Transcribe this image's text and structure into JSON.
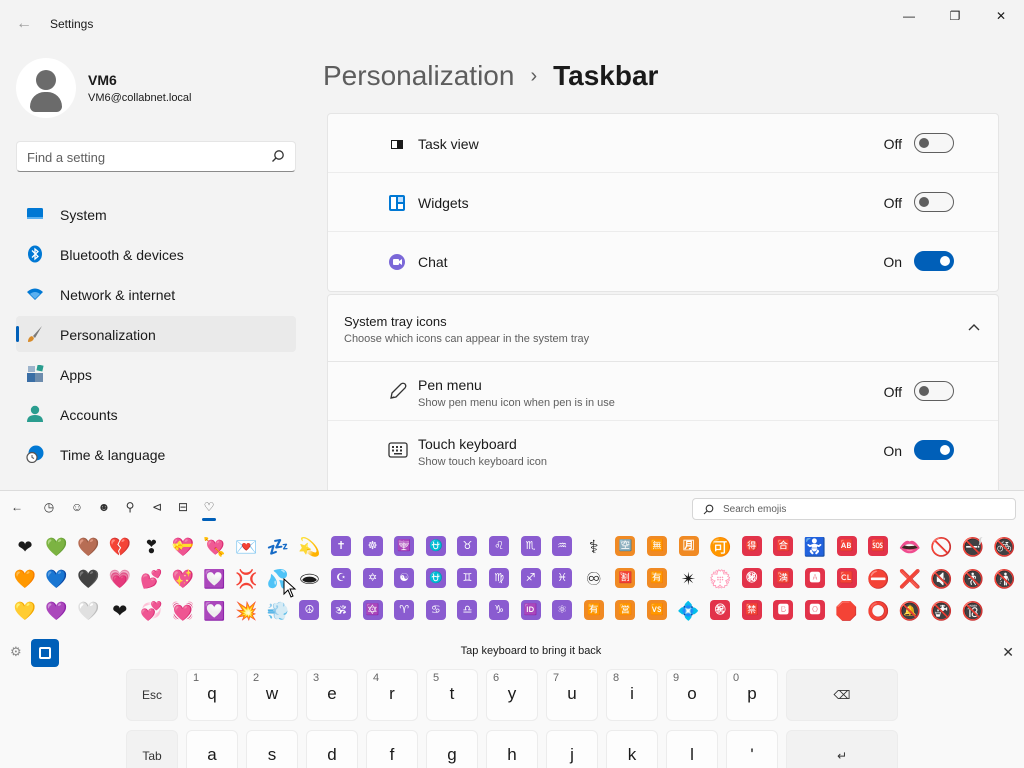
{
  "window": {
    "title": "Settings",
    "back_icon": "←",
    "minimize_icon": "—",
    "maximize_icon": "❐",
    "close_icon": "✕"
  },
  "profile": {
    "name": "VM6",
    "email": "VM6@collabnet.local"
  },
  "search": {
    "placeholder": "Find a setting"
  },
  "sidebar": {
    "items": [
      {
        "label": "System",
        "icon": "system-icon",
        "color": "#0078d4"
      },
      {
        "label": "Bluetooth & devices",
        "icon": "bluetooth-icon",
        "color": "#0078d4"
      },
      {
        "label": "Network & internet",
        "icon": "wifi-icon",
        "color": "#0078d4"
      },
      {
        "label": "Personalization",
        "icon": "brush-icon",
        "color": "#d88b2a",
        "active": true
      },
      {
        "label": "Apps",
        "icon": "apps-icon",
        "color": "#3a6ea5"
      },
      {
        "label": "Accounts",
        "icon": "person-icon",
        "color": "#2a9d8f"
      },
      {
        "label": "Time & language",
        "icon": "globe-clock-icon",
        "color": "#0078d4"
      }
    ]
  },
  "breadcrumb": {
    "parent": "Personalization",
    "separator": "›",
    "current": "Taskbar"
  },
  "taskbar_items": [
    {
      "label": "Task view",
      "state": "Off",
      "icon": "task-view-icon"
    },
    {
      "label": "Widgets",
      "state": "Off",
      "icon": "widgets-icon"
    },
    {
      "label": "Chat",
      "state": "On",
      "icon": "chat-icon"
    }
  ],
  "system_tray": {
    "title": "System tray icons",
    "subtitle": "Choose which icons can appear in the system tray",
    "items": [
      {
        "label": "Pen menu",
        "sub": "Show pen menu icon when pen is in use",
        "state": "Off",
        "icon": "pen-icon"
      },
      {
        "label": "Touch keyboard",
        "sub": "Show touch keyboard icon",
        "state": "On",
        "icon": "keyboard-icon"
      }
    ]
  },
  "emoji_panel": {
    "search_placeholder": "Search emojis",
    "tabs": [
      "back-icon",
      "recent-icon",
      "smiley-icon",
      "people-icon",
      "balloon-icon",
      "food-icon",
      "car-icon",
      "heart-icon"
    ],
    "rows": [
      [
        "❤",
        "💚",
        "🤎",
        "💔",
        "❣",
        "💝",
        "💘",
        "💌",
        "💤",
        "💫",
        "✝",
        "☸",
        "🕎",
        "⛎",
        "♉",
        "♌",
        "♏",
        "♒",
        "⚕",
        "🈳",
        "🈚",
        "🈷",
        "🉑",
        "🉐",
        "🈴",
        "🚼",
        "🆎",
        "🆘",
        "👄",
        "🚫",
        "🚭",
        "🚳"
      ],
      [
        "🧡",
        "💙",
        "🖤",
        "💗",
        "💕",
        "💖",
        "💟",
        "💢",
        "💦",
        "🕳",
        "☪",
        "✡",
        "☯",
        "⛎",
        "♊",
        "♍",
        "♐",
        "♓",
        "♾",
        "🈹",
        "🈶",
        "✴",
        "💮",
        "㊙",
        "🈵",
        "🅰",
        "🆑",
        "⛔",
        "❌",
        "🔇",
        "🚷",
        "🚯"
      ],
      [
        "💛",
        "💜",
        "🤍",
        "❤",
        "💞",
        "💓",
        "💟",
        "💥",
        "💨",
        "☮",
        "🕉",
        "🔯",
        "♈",
        "♋",
        "♎",
        "♑",
        "🆔",
        "⚛",
        "🈶",
        "🈺",
        "🆚",
        "💠",
        "㊗",
        "🈲",
        "🅱",
        "🅾",
        "🛑",
        "⭕",
        "🔕",
        "🚱",
        "🔞"
      ]
    ]
  },
  "keyboard": {
    "hint": "Tap keyboard to bring it back",
    "row1": [
      {
        "main": "Esc",
        "alt": "",
        "fn": true
      },
      {
        "main": "q",
        "alt": "1"
      },
      {
        "main": "w",
        "alt": "2"
      },
      {
        "main": "e",
        "alt": "3"
      },
      {
        "main": "r",
        "alt": "4"
      },
      {
        "main": "t",
        "alt": "5"
      },
      {
        "main": "y",
        "alt": "6"
      },
      {
        "main": "u",
        "alt": "7"
      },
      {
        "main": "i",
        "alt": "8"
      },
      {
        "main": "o",
        "alt": "9"
      },
      {
        "main": "p",
        "alt": "0"
      },
      {
        "main": "⌫",
        "alt": "",
        "fn": true
      }
    ],
    "row2": [
      {
        "main": "Tab",
        "alt": "",
        "fn": true
      },
      {
        "main": "a",
        "alt": ""
      },
      {
        "main": "s",
        "alt": ""
      },
      {
        "main": "d",
        "alt": ""
      },
      {
        "main": "f",
        "alt": ""
      },
      {
        "main": "g",
        "alt": ""
      },
      {
        "main": "h",
        "alt": ""
      },
      {
        "main": "j",
        "alt": ""
      },
      {
        "main": "k",
        "alt": ""
      },
      {
        "main": "l",
        "alt": ""
      },
      {
        "main": "'",
        "alt": ""
      },
      {
        "main": "↵",
        "alt": "",
        "fn": true
      }
    ]
  },
  "colors": {
    "accent": "#005fb8",
    "purple_symbol": "#8a5cd0",
    "red_symbol": "#e2334a",
    "orange_symbol": "#f08a24",
    "blue_symbol": "#1e90ff"
  }
}
